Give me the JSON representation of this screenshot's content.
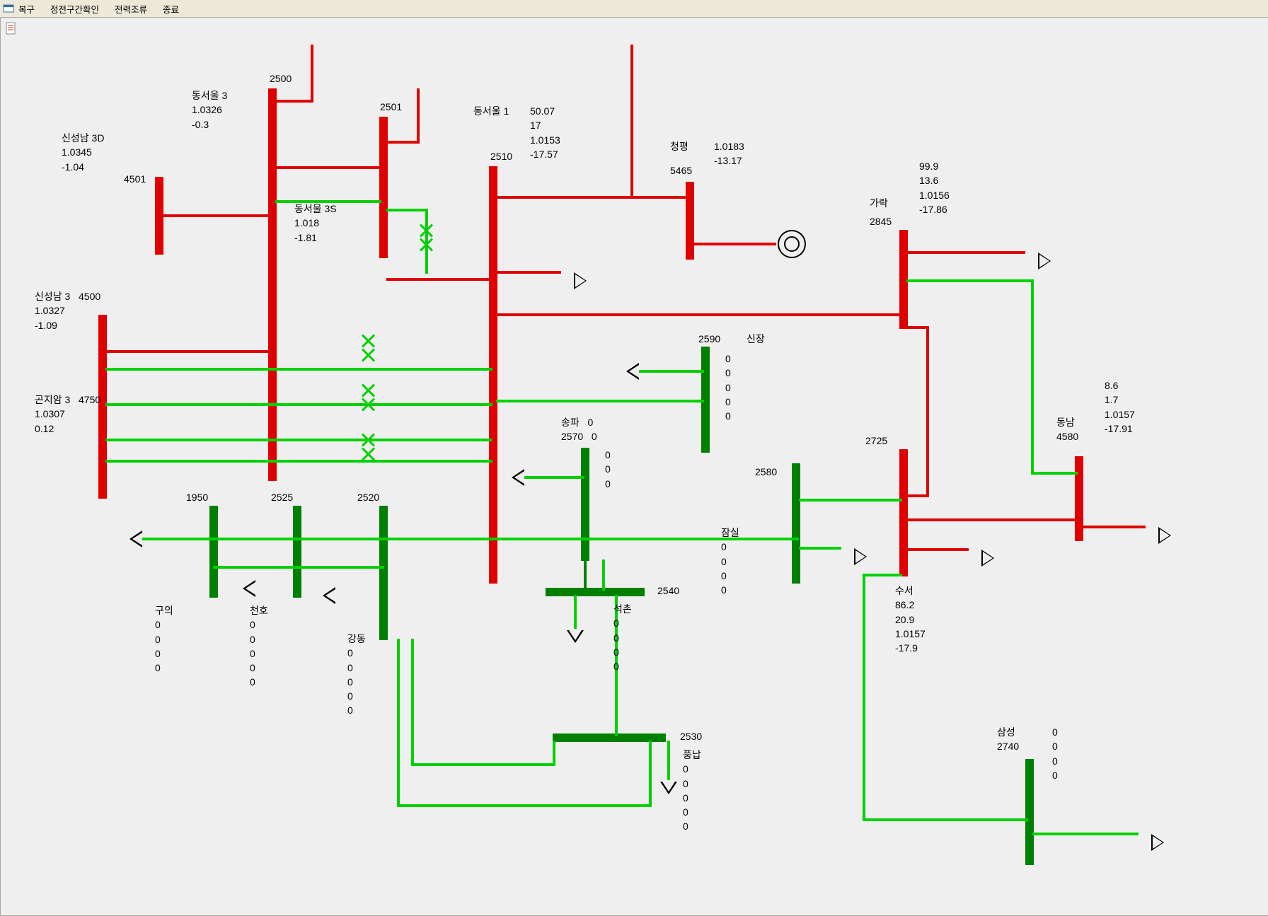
{
  "menu": {
    "restore": "복구",
    "outage": "정전구간확인",
    "flow": "전력조류",
    "exit": "종료"
  },
  "buses": {
    "sinseongnam3D": {
      "name": "신성남 3D",
      "id": "4501",
      "vals": [
        "1.0345",
        "-1.04"
      ]
    },
    "sinseongnam3": {
      "name": "신성남 3",
      "id": "4500",
      "vals": [
        "1.0327",
        "-1.09"
      ]
    },
    "gonjiam3": {
      "name": "곤지암 3",
      "id": "4750",
      "vals": [
        "1.0307",
        "0.12"
      ]
    },
    "dongseoul3": {
      "name": "동서울 3",
      "id": "2500",
      "vals": [
        "1.0326",
        "-0.3"
      ]
    },
    "dongseoul3S": {
      "name": "동서울 3S",
      "id": "2501",
      "vals": [
        "1.018",
        "-1.81"
      ]
    },
    "dongseoul1": {
      "name": "동서울 1",
      "id": "2510",
      "vals": [
        "50.07",
        "17",
        "1.0153",
        "-17.57"
      ]
    },
    "cheongpyeong": {
      "name": "청평",
      "id": "5465",
      "vals": [
        "1.0183",
        "-13.17"
      ]
    },
    "garak": {
      "name": "가락",
      "id": "2845",
      "vals": [
        "99.9",
        "13.6",
        "1.0156",
        "-17.86"
      ]
    },
    "sinjang": {
      "name": "신장",
      "id": "2590",
      "vals": [
        "0",
        "0",
        "0",
        "0",
        "0"
      ]
    },
    "songpa": {
      "name": "송파",
      "id": "2570",
      "vals": [
        "0",
        "0",
        "0",
        "0",
        "0"
      ]
    },
    "jamsil": {
      "name": "잠실",
      "id": "2580",
      "vals": [
        "0",
        "0",
        "0",
        "0"
      ]
    },
    "suseo": {
      "name": "수서",
      "id": "2725",
      "vals": [
        "86.2",
        "20.9",
        "1.0157",
        "-17.9"
      ]
    },
    "dongnam": {
      "name": "동남",
      "id": "4580",
      "vals": [
        "8.6",
        "1.7",
        "1.0157",
        "-17.91"
      ]
    },
    "guui": {
      "name": "구의",
      "id": "1950",
      "vals": [
        "0",
        "0",
        "0",
        "0"
      ]
    },
    "cheonho": {
      "name": "천호",
      "id": "2525",
      "vals": [
        "0",
        "0",
        "0",
        "0",
        "0"
      ]
    },
    "gangdong": {
      "name": "강동",
      "id": "2520",
      "vals": [
        "0",
        "0",
        "0",
        "0",
        "0"
      ]
    },
    "seokchon": {
      "name": "석촌",
      "id": "2540",
      "vals": [
        "0",
        "0",
        "0",
        "0"
      ]
    },
    "pungnab": {
      "name": "풍납",
      "id": "2530",
      "vals": [
        "0",
        "0",
        "0",
        "0",
        "0"
      ]
    },
    "samsung": {
      "name": "삼성",
      "id": "2740",
      "vals": [
        "0",
        "0",
        "0",
        "0"
      ]
    }
  }
}
